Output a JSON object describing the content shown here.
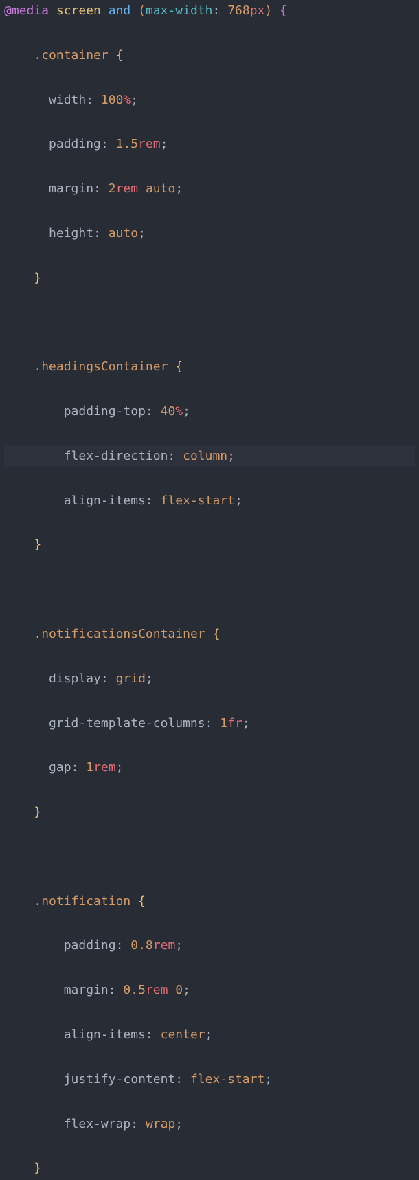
{
  "code": {
    "media": {
      "at": "@media",
      "screen": "screen",
      "and": "and",
      "feature": "max-width",
      "value": "768",
      "unit": "px"
    },
    "rules": [
      {
        "selector": ".container",
        "decls": [
          {
            "prop": "width",
            "value": "100",
            "unit": "%"
          },
          {
            "prop": "padding",
            "value": "1.5",
            "unit": "rem"
          },
          {
            "prop": "margin",
            "value": "2",
            "unit": "rem",
            "extra": "auto"
          },
          {
            "prop": "height",
            "valueKeyword": "auto"
          }
        ]
      },
      {
        "selector": ".headingsContainer",
        "indent": 8,
        "decls": [
          {
            "prop": "padding-top",
            "value": "40",
            "unit": "%"
          },
          {
            "prop": "flex-direction",
            "valueKeyword": "column"
          },
          {
            "prop": "align-items",
            "valueKeyword": "flex-start"
          }
        ]
      },
      {
        "selector": ".notificationsContainer",
        "decls": [
          {
            "prop": "display",
            "valueKeyword": "grid"
          },
          {
            "prop": "grid-template-columns",
            "value": "1",
            "unit": "fr"
          },
          {
            "prop": "gap",
            "value": "1",
            "unit": "rem"
          }
        ]
      },
      {
        "selector": ".notification",
        "indent": 8,
        "decls": [
          {
            "prop": "padding",
            "value": "0.8",
            "unit": "rem"
          },
          {
            "prop": "margin",
            "value": "0.5",
            "unit": "rem",
            "extra": "0"
          },
          {
            "prop": "align-items",
            "valueKeyword": "center"
          },
          {
            "prop": "justify-content",
            "valueKeyword": "flex-start"
          },
          {
            "prop": "flex-wrap",
            "valueKeyword": "wrap"
          }
        ]
      }
    ]
  }
}
